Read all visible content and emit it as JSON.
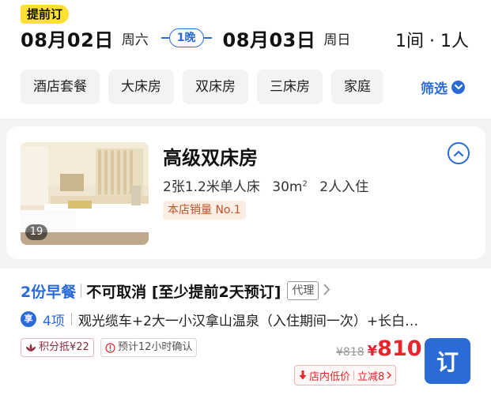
{
  "header": {
    "early_tag": "提前订",
    "checkin_date": "08月02日",
    "checkin_week": "周六",
    "nights": "1晚",
    "checkout_date": "08月03日",
    "checkout_week": "周日",
    "guests": "1间 · 1人"
  },
  "filters": {
    "chips": [
      "酒店套餐",
      "大床房",
      "双床房",
      "三床房",
      "家庭"
    ],
    "filter_label": "筛选"
  },
  "room": {
    "title": "高级双床房",
    "info_beds": "2张1.2米单人床",
    "info_area": "30m",
    "info_area_unit": "2",
    "info_guests": "2人入住",
    "sales_badge": "本店销量 No.1",
    "photo_count": "19"
  },
  "rate": {
    "breakfast": "2份早餐",
    "cancel_policy": "不可取消 [至少提前2天预订]",
    "agent_tag": "代理",
    "enjoy_icon_text": "享",
    "items_count": "4项",
    "items_text": "观光缆车+2大一小汉拿山温泉（入住期间一次）+长白…",
    "points_tag": "积分抵¥22",
    "confirm_tag": "预计12小时确认",
    "original_price": "¥818",
    "price_symbol": "¥",
    "price_value": "810",
    "low_price_label": "店内低价",
    "discount_label": "立减8",
    "book_label": "订"
  },
  "colors": {
    "accent": "#2b6bd6",
    "price": "#e8242c",
    "early_tag_bg": "#ffe033",
    "badge_bg": "#fdeee4",
    "badge_text": "#c0522a"
  },
  "icons": {
    "collapse": "chevron-up-circle-icon",
    "filter": "chevron-down-icon",
    "agent_more": "chevron-right-icon",
    "points": "lotus-icon",
    "confirm": "exclamation-circle-icon",
    "low_price": "arrow-down-icon"
  }
}
